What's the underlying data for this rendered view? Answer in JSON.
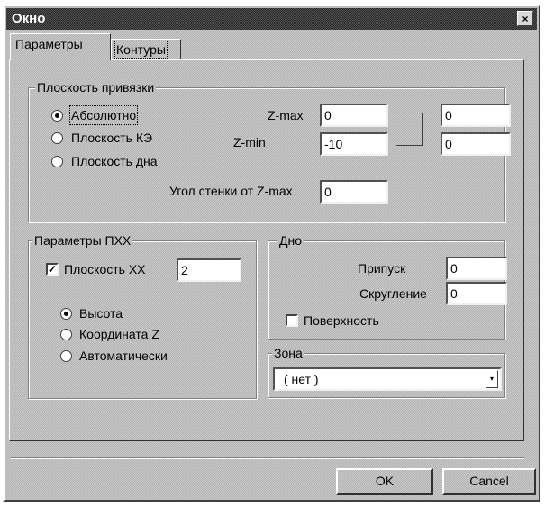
{
  "window": {
    "title": "Окно",
    "close_glyph": "×"
  },
  "tabs": [
    {
      "label": "Параметры"
    },
    {
      "label": "Контуры"
    }
  ],
  "reference_plane": {
    "title": "Плоскость привязки",
    "options": [
      {
        "label": "Абсолютно",
        "selected": true
      },
      {
        "label": "Плоскость КЭ",
        "selected": false
      },
      {
        "label": "Плоскость дна",
        "selected": false
      }
    ],
    "zmax_label": "Z-max",
    "zmax_value": "0",
    "zmin_label": "Z-min",
    "zmin_value": "-10",
    "linked_top_value": "0",
    "linked_bottom_value": "0",
    "wall_angle_label": "Угол стенки от Z-max",
    "wall_angle_value": "0"
  },
  "pxx": {
    "title": "Параметры ПХХ",
    "plane_checkbox_label": "Плоскость ХХ",
    "plane_checked": true,
    "plane_value": "2",
    "options": [
      {
        "label": "Высота",
        "selected": true
      },
      {
        "label": "Координата Z",
        "selected": false
      },
      {
        "label": "Автоматически",
        "selected": false
      }
    ]
  },
  "bottom": {
    "title": "Дно",
    "allowance_label": "Припуск",
    "allowance_value": "0",
    "rounding_label": "Скругление",
    "rounding_value": "0",
    "surface_label": "Поверхность",
    "surface_checked": false
  },
  "zone": {
    "title": "Зона",
    "selected": "( нет )"
  },
  "buttons": {
    "ok": "OK",
    "cancel": "Cancel"
  },
  "icons": {
    "check_glyph": "✓",
    "dropdown": "chevron-down-icon"
  }
}
